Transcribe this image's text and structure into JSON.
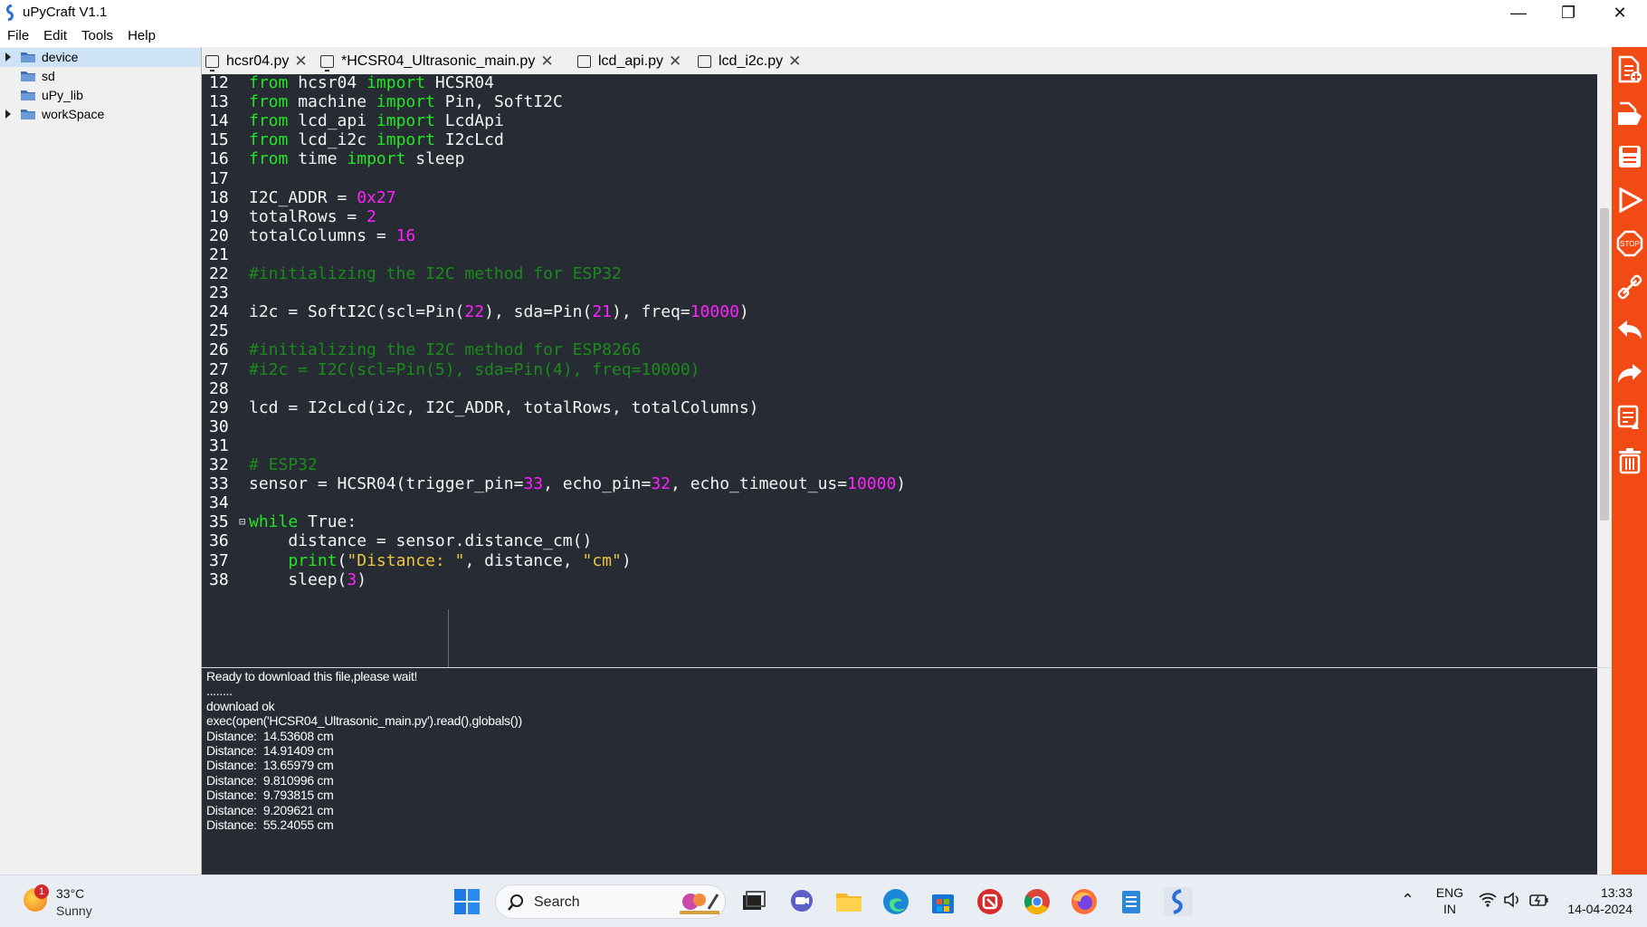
{
  "window": {
    "title": "uPyCraft V1.1"
  },
  "menu": [
    "File",
    "Edit",
    "Tools",
    "Help"
  ],
  "tree": [
    {
      "label": "device",
      "expandable": true,
      "selected": true
    },
    {
      "label": "sd",
      "expandable": false,
      "selected": false
    },
    {
      "label": "uPy_lib",
      "expandable": false,
      "selected": false
    },
    {
      "label": "workSpace",
      "expandable": true,
      "selected": false
    }
  ],
  "tabs": [
    {
      "label": "hcsr04.py",
      "icon": "monitor-icon"
    },
    {
      "label": "*HCSR04_Ultrasonic_main.py",
      "icon": "monitor-icon"
    },
    {
      "label": "lcd_api.py",
      "icon": "file-icon"
    },
    {
      "label": "lcd_i2c.py",
      "icon": "file-icon"
    }
  ],
  "editor": {
    "lines": [
      {
        "n": "12",
        "t": [
          [
            "kw",
            "from"
          ],
          [
            "p",
            " hcsr04 "
          ],
          [
            "kw",
            "import"
          ],
          [
            "p",
            " HCSR04"
          ]
        ]
      },
      {
        "n": "13",
        "t": [
          [
            "kw",
            "from"
          ],
          [
            "p",
            " machine "
          ],
          [
            "kw",
            "import"
          ],
          [
            "p",
            " Pin, SoftI2C"
          ]
        ]
      },
      {
        "n": "14",
        "t": [
          [
            "kw",
            "from"
          ],
          [
            "p",
            " lcd_api "
          ],
          [
            "kw",
            "import"
          ],
          [
            "p",
            " LcdApi"
          ]
        ]
      },
      {
        "n": "15",
        "t": [
          [
            "kw",
            "from"
          ],
          [
            "p",
            " lcd_i2c "
          ],
          [
            "kw",
            "import"
          ],
          [
            "p",
            " I2cLcd"
          ]
        ]
      },
      {
        "n": "16",
        "t": [
          [
            "kw",
            "from"
          ],
          [
            "p",
            " time "
          ],
          [
            "kw",
            "import"
          ],
          [
            "p",
            " sleep"
          ]
        ]
      },
      {
        "n": "17",
        "t": []
      },
      {
        "n": "18",
        "t": [
          [
            "p",
            "I2C_ADDR = "
          ],
          [
            "num",
            "0x27"
          ]
        ]
      },
      {
        "n": "19",
        "t": [
          [
            "p",
            "totalRows = "
          ],
          [
            "num",
            "2"
          ]
        ]
      },
      {
        "n": "20",
        "t": [
          [
            "p",
            "totalColumns = "
          ],
          [
            "num",
            "16"
          ]
        ]
      },
      {
        "n": "21",
        "t": []
      },
      {
        "n": "22",
        "t": [
          [
            "cmt",
            "#initializing the I2C method for ESP32"
          ]
        ]
      },
      {
        "n": "23",
        "t": []
      },
      {
        "n": "24",
        "t": [
          [
            "p",
            "i2c = SoftI2C(scl=Pin("
          ],
          [
            "num",
            "22"
          ],
          [
            "p",
            "), sda=Pin("
          ],
          [
            "num",
            "21"
          ],
          [
            "p",
            "), freq="
          ],
          [
            "num",
            "10000"
          ],
          [
            "p",
            ")"
          ]
        ]
      },
      {
        "n": "25",
        "t": []
      },
      {
        "n": "26",
        "t": [
          [
            "cmt",
            "#initializing the I2C method for ESP8266"
          ]
        ]
      },
      {
        "n": "27",
        "t": [
          [
            "cmt",
            "#i2c = I2C(scl=Pin(5), sda=Pin(4), freq=10000)"
          ]
        ]
      },
      {
        "n": "28",
        "t": []
      },
      {
        "n": "29",
        "t": [
          [
            "p",
            "lcd = I2cLcd(i2c, I2C_ADDR, totalRows, totalColumns)"
          ]
        ]
      },
      {
        "n": "30",
        "t": []
      },
      {
        "n": "31",
        "t": []
      },
      {
        "n": "32",
        "t": [
          [
            "cmt",
            "# ESP32"
          ]
        ]
      },
      {
        "n": "33",
        "t": [
          [
            "p",
            "sensor = HCSR04(trigger_pin="
          ],
          [
            "num",
            "33"
          ],
          [
            "p",
            ", echo_pin="
          ],
          [
            "num",
            "32"
          ],
          [
            "p",
            ", echo_timeout_us="
          ],
          [
            "num",
            "10000"
          ],
          [
            "p",
            ")"
          ]
        ]
      },
      {
        "n": "34",
        "t": []
      },
      {
        "n": "35",
        "t": [
          [
            "kw",
            "while"
          ],
          [
            "p",
            " True:"
          ]
        ],
        "fold": true
      },
      {
        "n": "36",
        "t": [
          [
            "p",
            "    distance = sensor.distance_cm()"
          ]
        ]
      },
      {
        "n": "37",
        "t": [
          [
            "p",
            "    "
          ],
          [
            "kw",
            "print"
          ],
          [
            "p",
            "("
          ],
          [
            "str",
            "\"Distance: \""
          ],
          [
            "p",
            ", distance, "
          ],
          [
            "str",
            "\"cm\""
          ],
          [
            "p",
            ")"
          ]
        ]
      },
      {
        "n": "38",
        "t": [
          [
            "p",
            "    sleep("
          ],
          [
            "num",
            "3"
          ],
          [
            "p",
            ")"
          ]
        ]
      }
    ]
  },
  "console": [
    "Ready to download this file,please wait!",
    "........",
    "download ok",
    "exec(open('HCSR04_Ultrasonic_main.py').read(),globals())",
    "Distance:  14.53608 cm",
    "Distance:  14.91409 cm",
    "Distance:  13.65979 cm",
    "Distance:  9.810996 cm",
    "Distance:  9.793815 cm",
    "Distance:  9.209621 cm",
    "Distance:  55.24055 cm"
  ],
  "toolbar": [
    "new-file-icon",
    "open-file-icon",
    "save-icon",
    "run-icon",
    "stop-icon",
    "connect-icon",
    "undo-icon",
    "redo-icon",
    "syntax-check-icon",
    "clear-icon"
  ],
  "taskbar": {
    "weather": {
      "badge": "1",
      "temp": "33°C",
      "cond": "Sunny"
    },
    "search_label": "Search",
    "tray": {
      "lang": "ENG",
      "region": "IN"
    },
    "clock": {
      "time": "13:33",
      "date": "14-04-2024"
    }
  },
  "colors": {
    "editor_bg": "#272c34",
    "keyword": "#23e523",
    "number": "#ff20ff",
    "comment": "#1b8a1b",
    "string": "#ecc53c",
    "toolbar": "#f24a14"
  }
}
